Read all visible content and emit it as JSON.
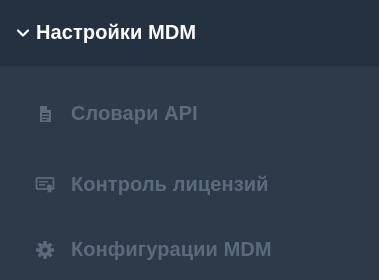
{
  "section": {
    "title": "Настройки MDM",
    "expanded": true,
    "icon": "chevron-down-icon"
  },
  "items": [
    {
      "label": "Словари API",
      "icon": "document-icon"
    },
    {
      "label": "Контроль лицензий",
      "icon": "certificate-icon"
    },
    {
      "label": "Конфигурации MDM",
      "icon": "gear-icon"
    }
  ],
  "colors": {
    "header_bg": "#243140",
    "sidebar_bg": "#2c3a4a",
    "header_text": "#ffffff",
    "item_text": "#5b6a7c"
  }
}
